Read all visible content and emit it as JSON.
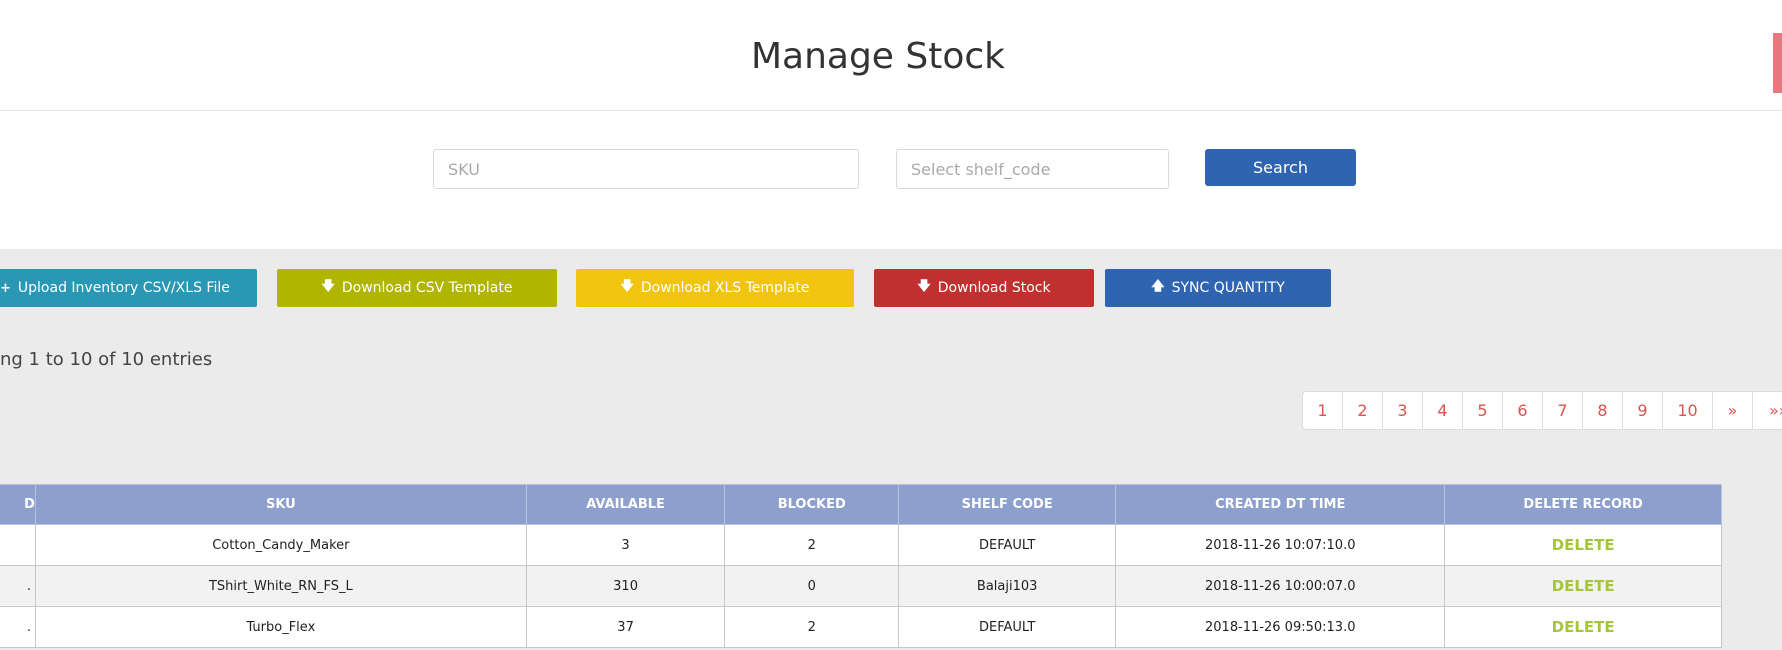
{
  "header": {
    "title": "Manage Stock"
  },
  "search": {
    "sku_placeholder": "SKU",
    "shelf_placeholder": "Select shelf_code",
    "button_label": "Search"
  },
  "actions": {
    "upload": "Upload Inventory CSV/XLS File",
    "download_csv": "Download CSV Template",
    "download_xls": "Download XLS Template",
    "download_stock": "Download Stock",
    "sync": "SYNC QUANTITY",
    "upload_icon": "plus-icon",
    "download_icon": "arrow-down-icon",
    "sync_icon": "arrow-up-icon"
  },
  "entries_info": "ng 1 to 10 of 10 entries",
  "pagination": {
    "pages": [
      "1",
      "2",
      "3",
      "4",
      "5",
      "6",
      "7",
      "8",
      "9",
      "10"
    ],
    "next": "»",
    "last": "»»"
  },
  "table": {
    "columns": {
      "id": "D",
      "sku": "SKU",
      "available": "AVAILABLE",
      "blocked": "BLOCKED",
      "shelf_code": "SHELF CODE",
      "created": "CREATED DT TIME",
      "delete": "DELETE RECORD"
    },
    "rows": [
      {
        "id": "",
        "sku": "Cotton_Candy_Maker",
        "available": "3",
        "blocked": "2",
        "shelf_code": "DEFAULT",
        "created": "2018-11-26 10:07:10.0",
        "delete": "DELETE"
      },
      {
        "id": ".",
        "sku": "TShirt_White_RN_FS_L",
        "available": "310",
        "blocked": "0",
        "shelf_code": "Balaji103",
        "created": "2018-11-26 10:00:07.0",
        "delete": "DELETE"
      },
      {
        "id": ".",
        "sku": "Turbo_Flex",
        "available": "37",
        "blocked": "2",
        "shelf_code": "DEFAULT",
        "created": "2018-11-26 09:50:13.0",
        "delete": "DELETE"
      }
    ]
  },
  "colors": {
    "primary": "#2f64b0",
    "upload": "#2a97b5",
    "csv": "#b0b500",
    "xls": "#f1c40f",
    "stock": "#c0302f",
    "table_header": "#8da0cd",
    "delete_link": "#a7c53a",
    "pagination_link": "#d9534f"
  }
}
